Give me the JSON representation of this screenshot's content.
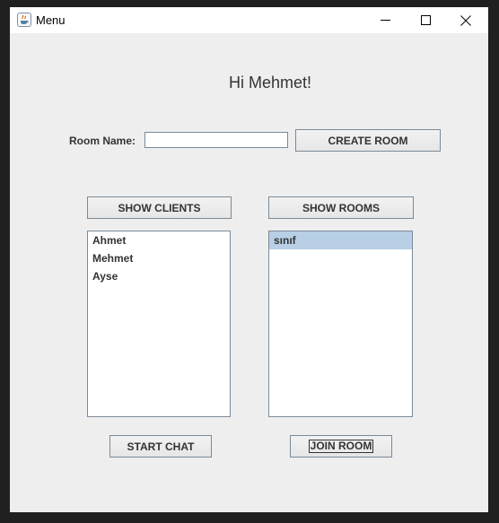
{
  "window": {
    "title": "Menu"
  },
  "greeting": "Hi Mehmet!",
  "room_form": {
    "label": "Room Name:",
    "input_value": "",
    "create_button": "CREATE ROOM"
  },
  "clients": {
    "button": "SHOW CLIENTS",
    "items": [
      "Ahmet",
      "Mehmet",
      "Ayse"
    ]
  },
  "rooms": {
    "button": "SHOW ROOMS",
    "items": [
      "sınıf"
    ],
    "selected_index": 0
  },
  "actions": {
    "start_chat": "START CHAT",
    "join_room": "JOIN ROOM"
  },
  "colors": {
    "selection": "#b8cfe5",
    "panel_background": "#eeeeee"
  },
  "icons": [
    "java-app-icon",
    "minimize-icon",
    "maximize-icon",
    "close-icon"
  ]
}
